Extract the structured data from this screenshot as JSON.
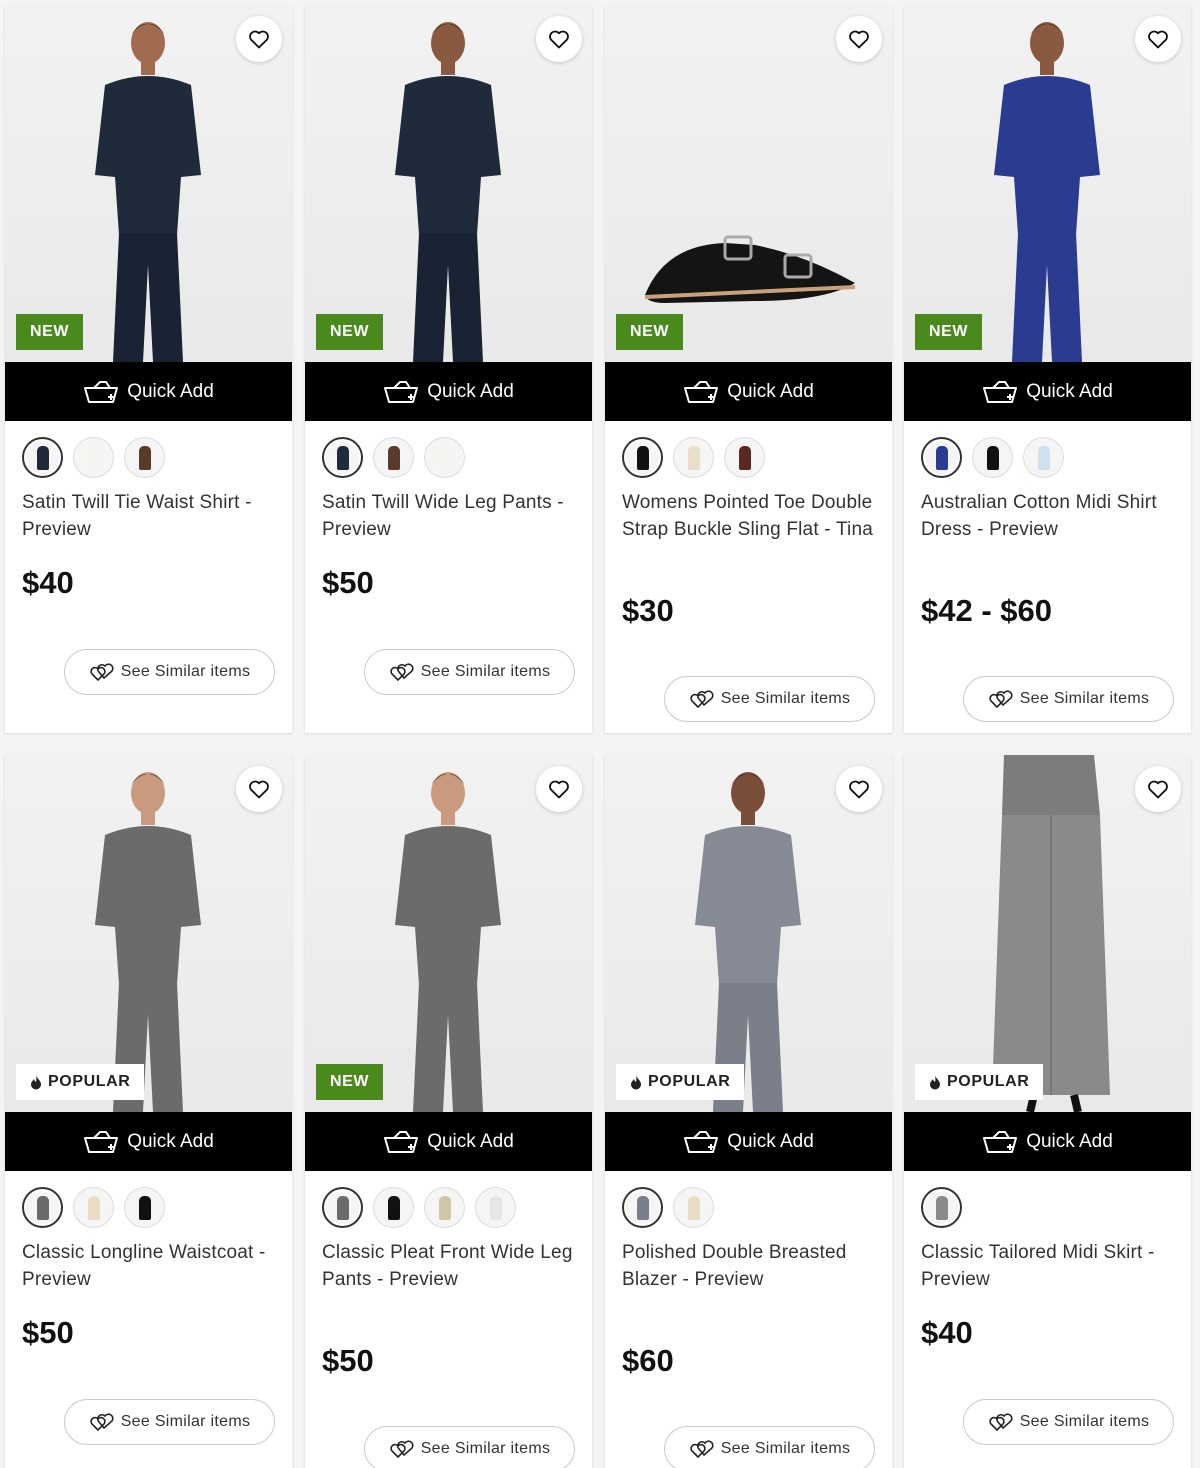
{
  "labels": {
    "quick_add": "Quick Add",
    "see_similar": "See Similar items"
  },
  "colors": {
    "new_badge": "#4a8a1c",
    "quick_add_bar": "#000000",
    "card_bg": "#ffffff"
  },
  "products": [
    {
      "name": "Satin Twill Tie Waist Shirt - Preview",
      "price": "$40",
      "badge": "NEW",
      "badge_type": "new",
      "icons": [
        "heart-icon",
        "basket-icon",
        "hearts-icon"
      ],
      "swatches": [
        "#1f2a3a",
        "#f4f4f0",
        "#5a3a2a"
      ]
    },
    {
      "name": "Satin Twill Wide Leg Pants - Preview",
      "price": "$50",
      "badge": "NEW",
      "badge_type": "new",
      "swatches": [
        "#1f2a3a",
        "#5a3a2a",
        "#f4f4f0"
      ]
    },
    {
      "name": "Womens Pointed Toe Double Strap Buckle Sling Flat - Tina",
      "price": "$30",
      "badge": "NEW",
      "badge_type": "new",
      "swatches": [
        "#111111",
        "#e9dfc9",
        "#5a2a20"
      ]
    },
    {
      "name": "Australian Cotton Midi Shirt Dress - Preview",
      "price": "$42 - $60",
      "badge": "NEW",
      "badge_type": "new",
      "swatches": [
        "#2b3b8f",
        "#111111",
        "#cfe0ef"
      ]
    },
    {
      "name": "Classic Longline Waistcoat - Preview",
      "price": "$50",
      "badge": "POPULAR",
      "badge_type": "popular",
      "swatches": [
        "#6b6b6b",
        "#e8dcc6",
        "#111111"
      ]
    },
    {
      "name": "Classic Pleat Front Wide Leg Pants - Preview",
      "price": "$50",
      "badge": "NEW",
      "badge_type": "new",
      "swatches": [
        "#6b6b6b",
        "#111111",
        "#cfc6a8",
        "#ffffff"
      ]
    },
    {
      "name": "Polished Double Breasted Blazer - Preview",
      "price": "$60",
      "badge": "POPULAR",
      "badge_type": "popular",
      "swatches": [
        "#7a7f8a",
        "#e8dcc6"
      ]
    },
    {
      "name": "Classic Tailored Midi Skirt - Preview",
      "price": "$40",
      "badge": "POPULAR",
      "badge_type": "popular",
      "swatches": [
        "#8a8a8a"
      ]
    }
  ]
}
